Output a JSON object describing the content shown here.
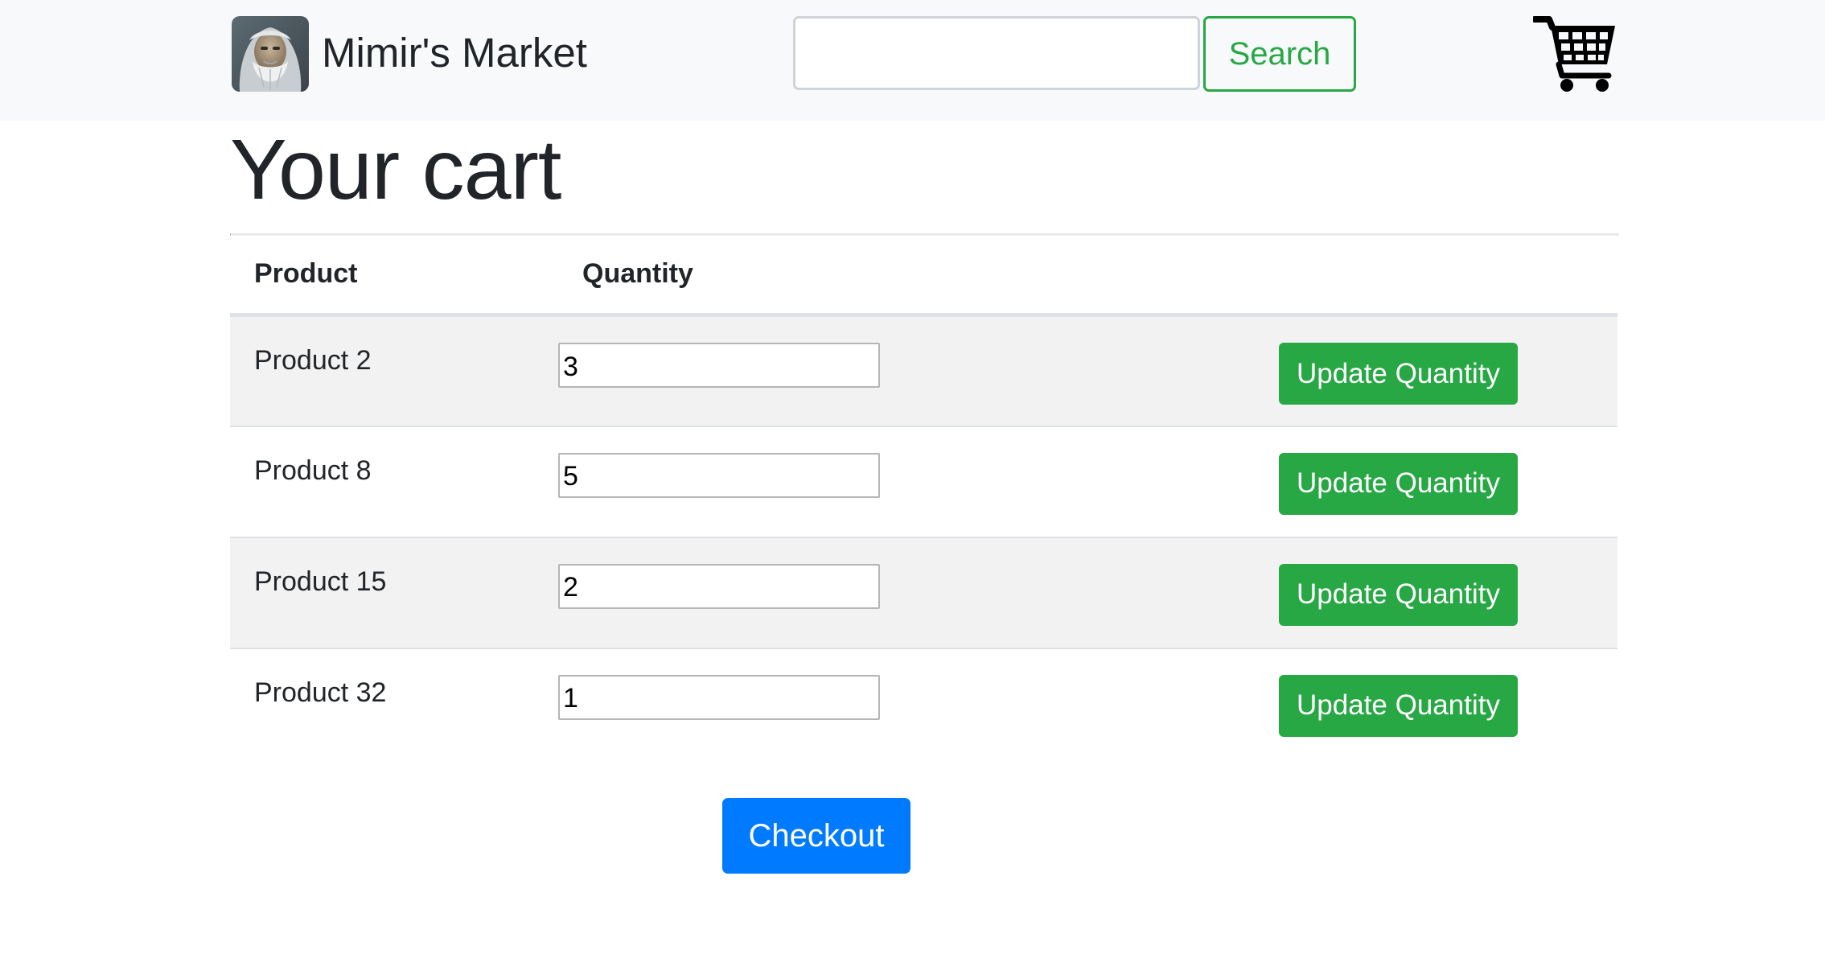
{
  "navbar": {
    "brand_name": "Mimir's Market",
    "search_placeholder": "",
    "search_value": "",
    "search_label": "Search"
  },
  "page": {
    "title": "Your cart"
  },
  "table": {
    "headers": {
      "product": "Product",
      "quantity": "Quantity",
      "actions": ""
    },
    "rows": [
      {
        "product": "Product 2",
        "quantity": "3",
        "action_label": "Update Quantity"
      },
      {
        "product": "Product 8",
        "quantity": "5",
        "action_label": "Update Quantity"
      },
      {
        "product": "Product 15",
        "quantity": "2",
        "action_label": "Update Quantity"
      },
      {
        "product": "Product 32",
        "quantity": "1",
        "action_label": "Update Quantity"
      }
    ]
  },
  "checkout": {
    "label": "Checkout"
  },
  "colors": {
    "navbar_bg": "#f8f9fa",
    "success": "#28a745",
    "primary": "#007bff",
    "row_stripe": "#f2f2f2"
  },
  "icons": {
    "logo": "wizard-portrait-logo",
    "cart": "shopping-cart-icon"
  }
}
